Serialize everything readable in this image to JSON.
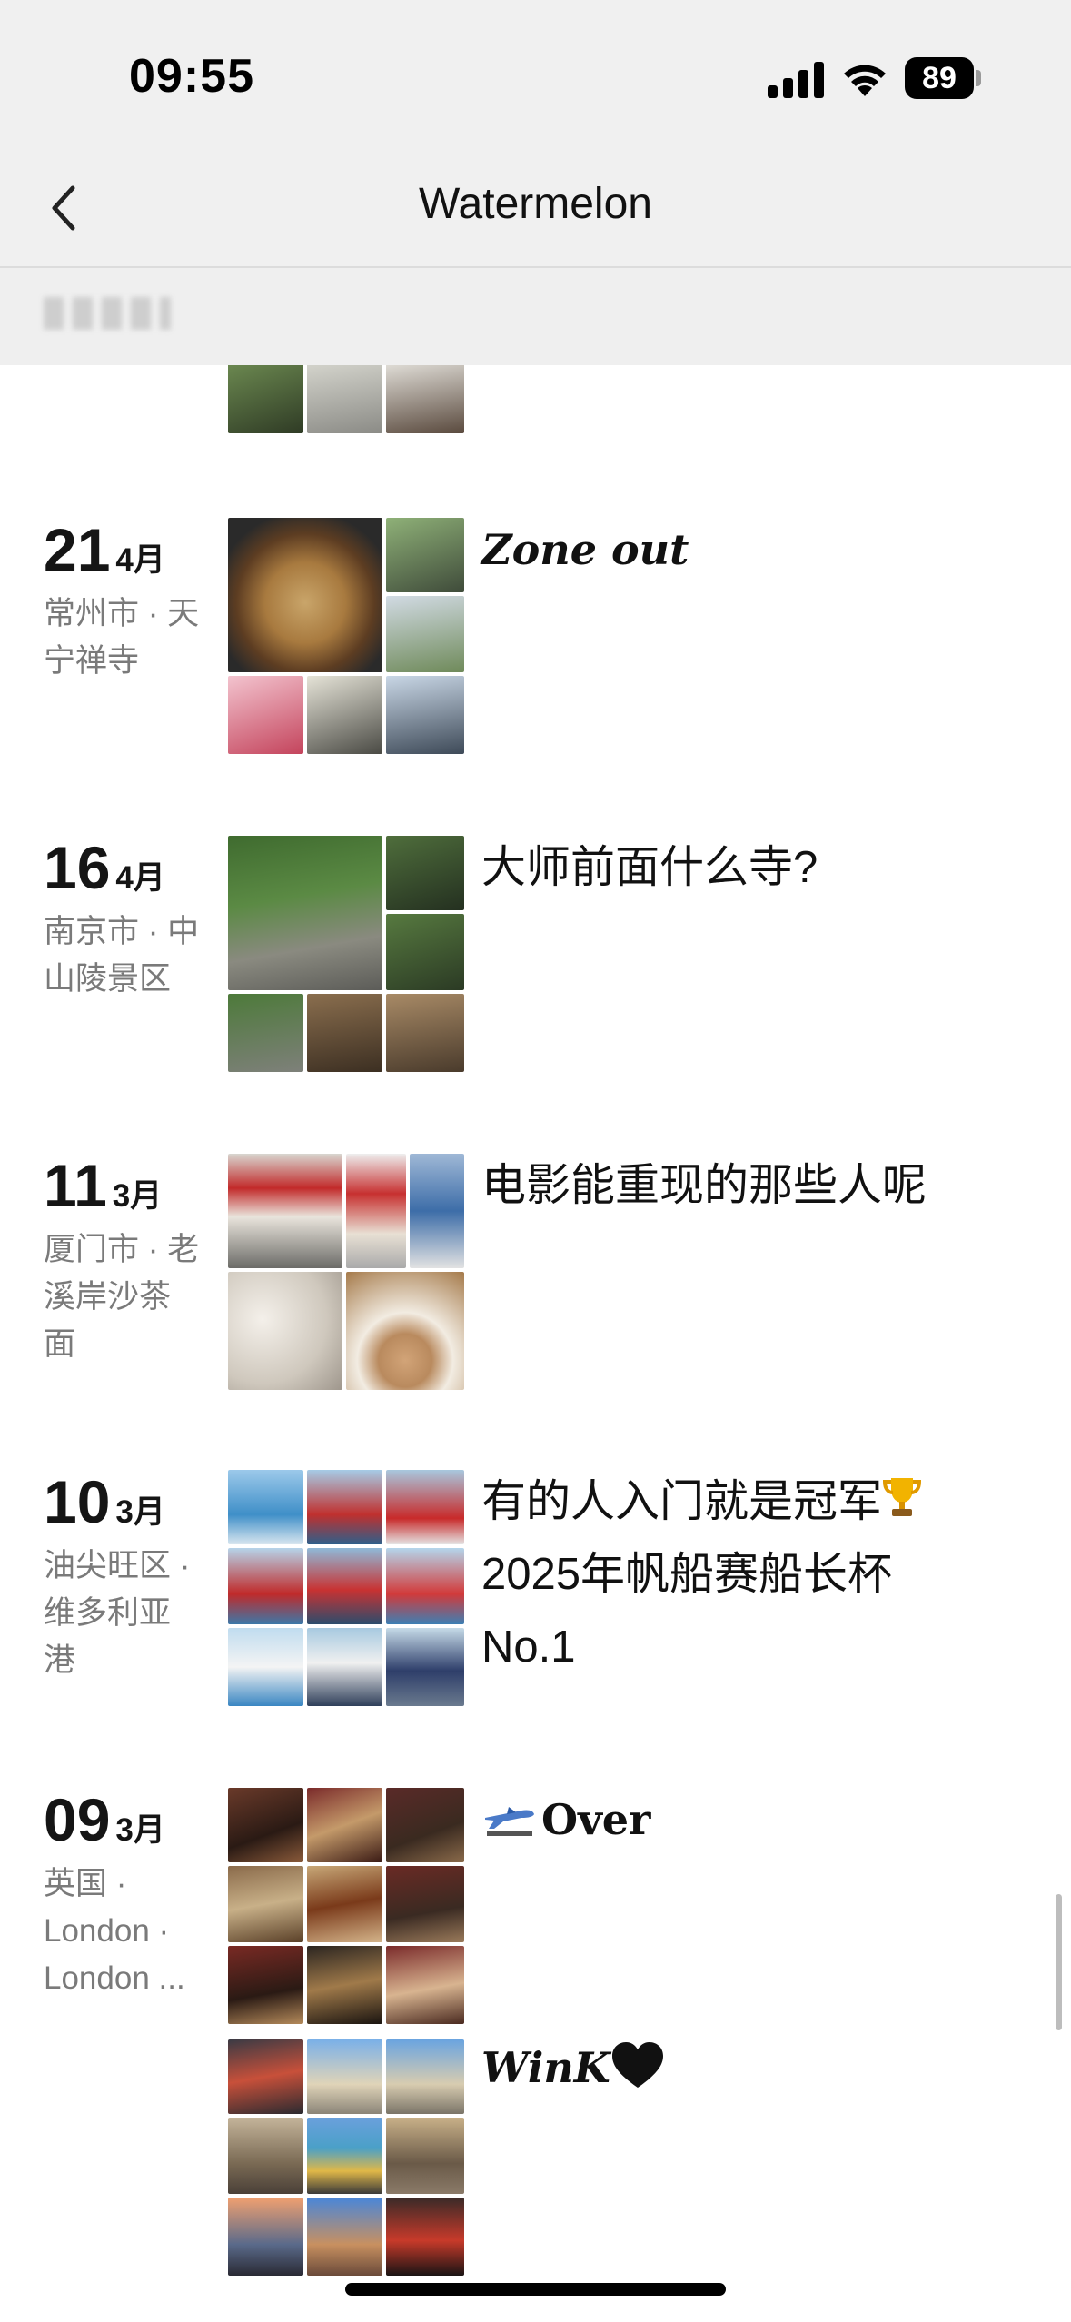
{
  "status_bar": {
    "time": "09:55",
    "battery": "89"
  },
  "nav": {
    "title": "Watermelon"
  },
  "entries": [
    {
      "day": "21",
      "month": "4月",
      "place": "常州市 · 天\n宁禅寺",
      "caption": "Zone out"
    },
    {
      "day": "16",
      "month": "4月",
      "place": "南京市 · 中\n山陵景区",
      "caption": "大师前面什么寺?"
    },
    {
      "day": "11",
      "month": "3月",
      "place": "厦门市 · 老\n溪岸沙茶\n面",
      "caption": "电影能重现的那些人呢"
    },
    {
      "day": "10",
      "month": "3月",
      "place": "油尖旺区 ·\n维多利亚\n港",
      "caption_line1": "有的人入门就是冠军",
      "caption_line2": "2025年帆船赛船长杯",
      "caption_line3": "No.1"
    },
    {
      "day": "09",
      "month": "3月",
      "place": "英国 ·\nLondon ·\nLondon ...",
      "caption": "Over",
      "caption2": "WinK"
    }
  ],
  "icons": {
    "back": "chevron-left-icon",
    "trophy": "trophy-icon",
    "plane": "airplane-icon",
    "heart": "black-heart-icon"
  },
  "colors": {
    "header_bg": "#f0f0f0",
    "place_text": "#7a7a7a"
  }
}
